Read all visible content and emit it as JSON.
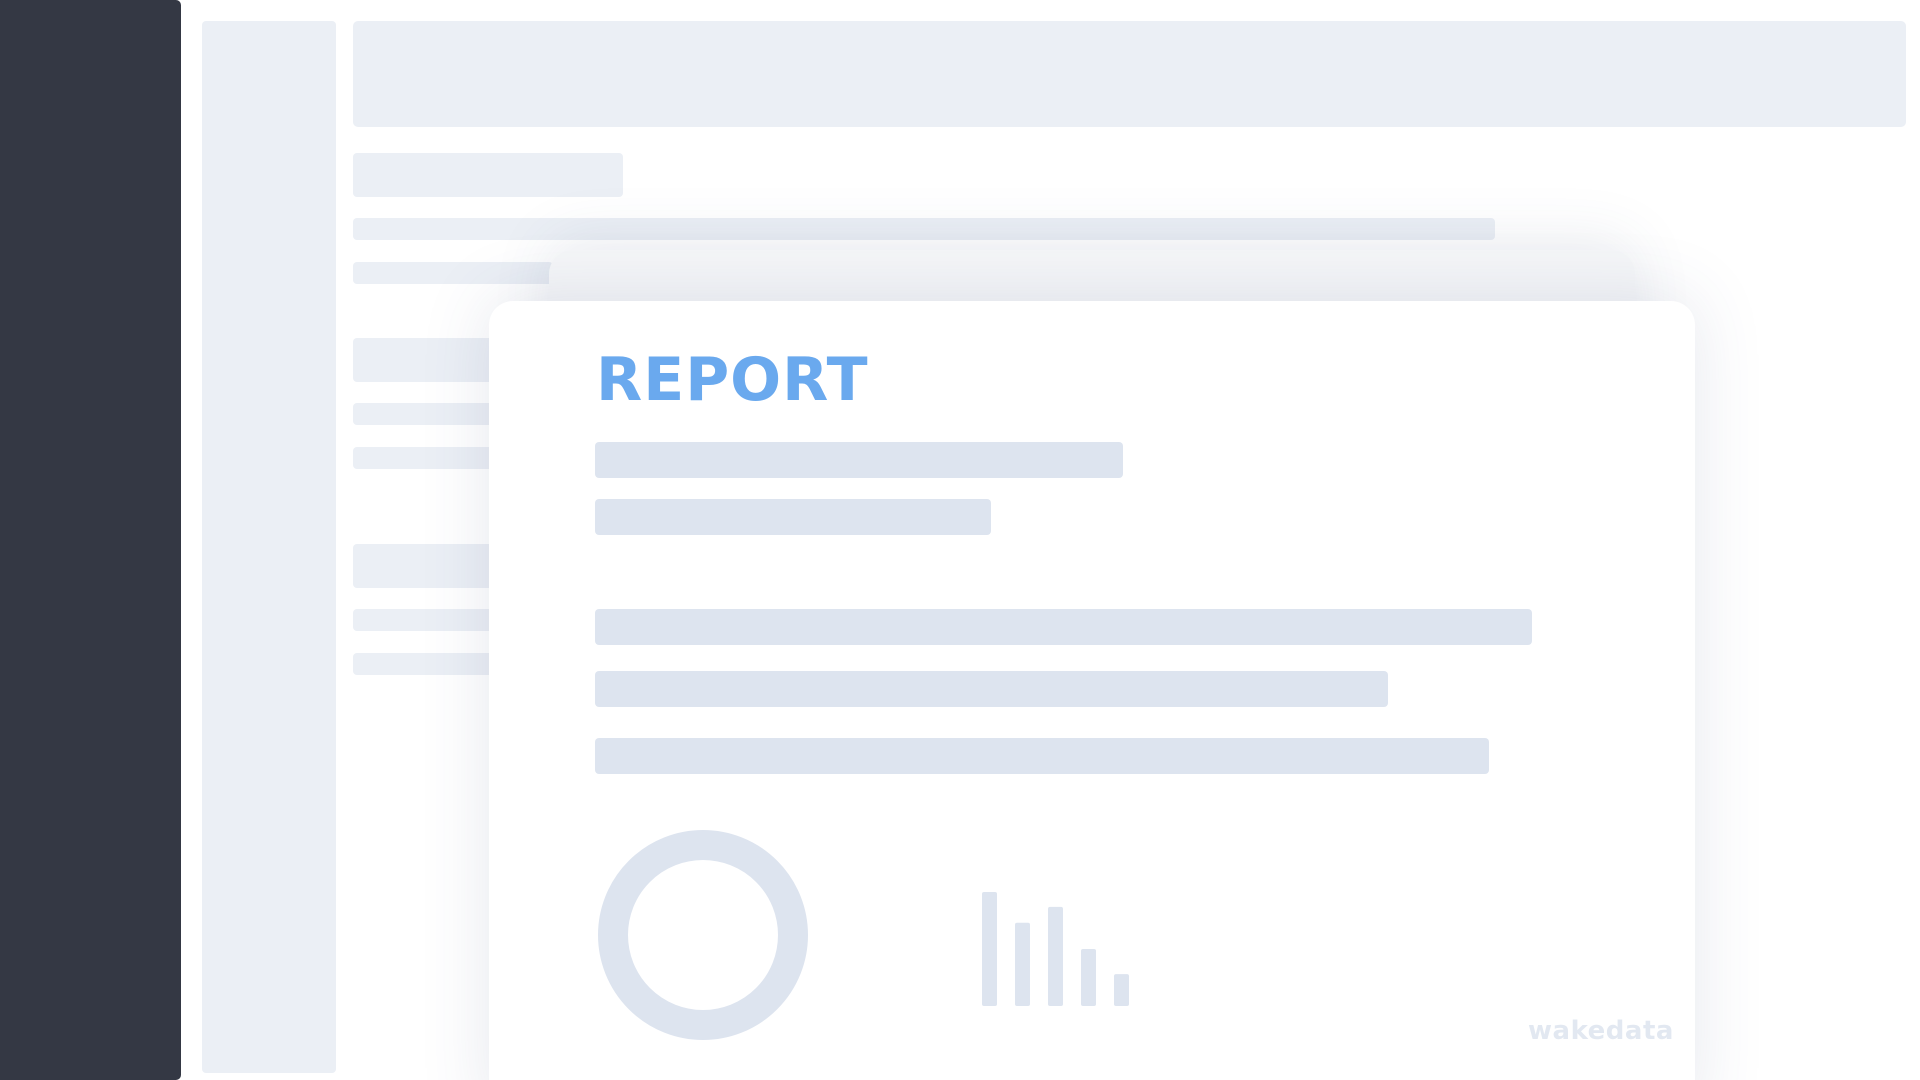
{
  "report": {
    "title": "REPORT",
    "watermark": "wakedata"
  },
  "colors": {
    "sidebar_dark": "#343844",
    "skeleton": "#ebeff5",
    "report_line": "#dde4ef",
    "accent": "#6aa9ee",
    "watermark": "#e2e8f1"
  },
  "chart_data": [
    {
      "type": "pie",
      "note_style": "donut",
      "values": [
        100
      ]
    },
    {
      "type": "bar",
      "values": [
        100,
        73,
        87,
        50,
        28
      ]
    }
  ]
}
